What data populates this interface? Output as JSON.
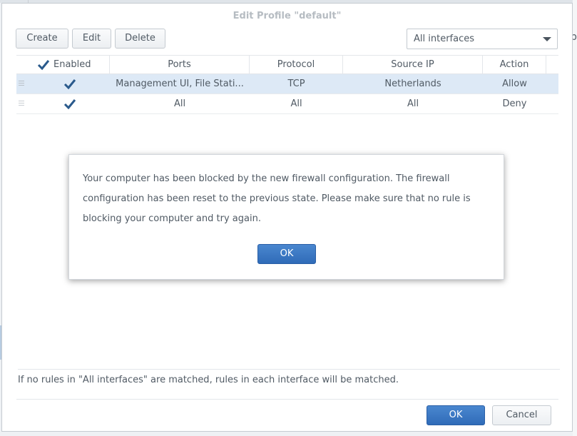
{
  "dialog": {
    "title": "Edit Profile \"default\"",
    "toolbar": {
      "create": "Create",
      "edit": "Edit",
      "delete": "Delete"
    },
    "interface_select": {
      "value": "All interfaces"
    },
    "columns": {
      "enabled": "Enabled",
      "ports": "Ports",
      "protocol": "Protocol",
      "source_ip": "Source IP",
      "action": "Action"
    },
    "rows": [
      {
        "enabled": true,
        "ports": "Management UI, File Stati...",
        "protocol": "TCP",
        "source_ip": "Netherlands",
        "action": "Allow",
        "selected": true
      },
      {
        "enabled": true,
        "ports": "All",
        "protocol": "All",
        "source_ip": "All",
        "action": "Deny",
        "selected": false
      }
    ],
    "footer_note": "If no rules in \"All interfaces\" are matched, rules in each interface will be matched.",
    "ok": "OK",
    "cancel": "Cancel"
  },
  "message_box": {
    "text": "Your computer has been blocked by the new firewall configuration. The firewall configuration has been reset to the previous state. Please make sure that no rule is blocking your computer and try again.",
    "ok": "OK"
  },
  "background": {
    "right_edge_text": "p"
  },
  "colors": {
    "primary_button": "#2f6bb8",
    "selected_row": "#dde9f6",
    "check": "#2a5a8c"
  },
  "icons": {
    "check": "checkmark-icon",
    "dropdown": "chevron-down-icon",
    "drag": "drag-handle-icon"
  }
}
